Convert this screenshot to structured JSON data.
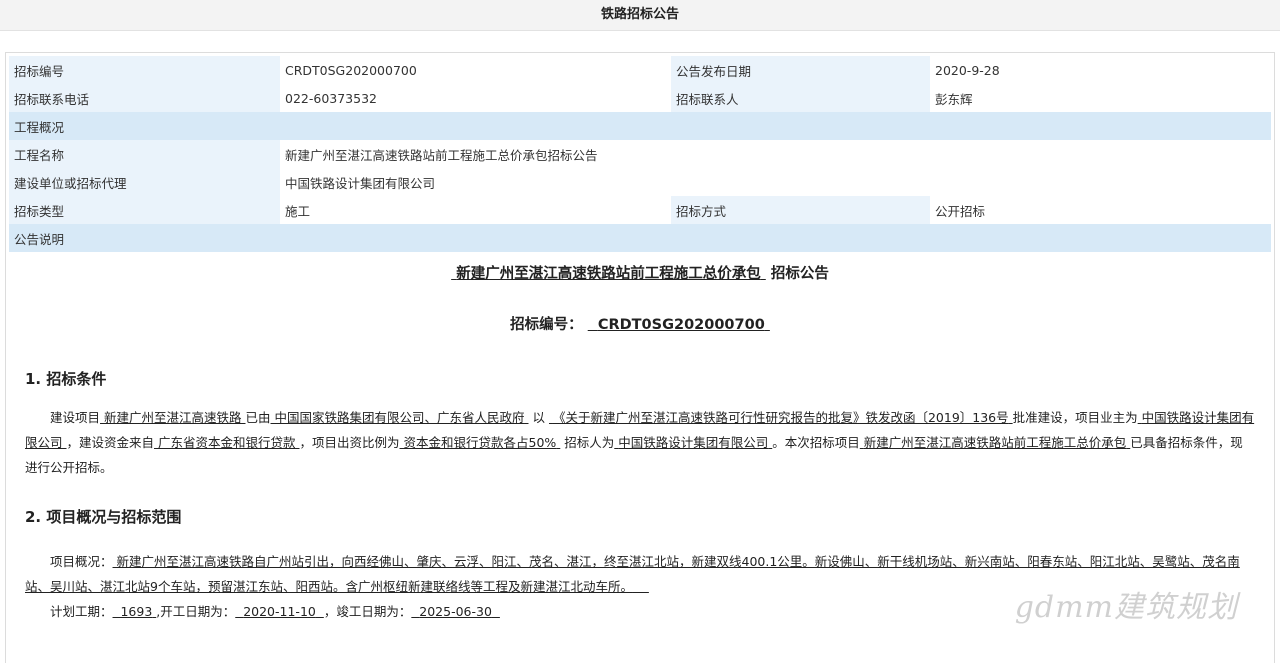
{
  "page_title": "铁路招标公告",
  "info": {
    "bid_no_label": "招标编号",
    "bid_no": "CRDT0SG202000700",
    "pub_date_label": "公告发布日期",
    "pub_date": "2020-9-28",
    "phone_label": "招标联系电话",
    "phone": "022-60373532",
    "contact_label": "招标联系人",
    "contact": "彭东辉",
    "overview_section": "工程概况",
    "project_name_label": "工程名称",
    "project_name": "新建广州至湛江高速铁路站前工程施工总价承包招标公告",
    "org_label": "建设单位或招标代理",
    "org": "中国铁路设计集团有限公司",
    "type_label": "招标类型",
    "type": "施工",
    "method_label": "招标方式",
    "method": "公开招标",
    "notice_section": "公告说明"
  },
  "doc": {
    "title_prefix": "新建广州至湛江高速铁路站前工程施工总价承包",
    "title_suffix": "招标公告",
    "bid_no_label": "招标编号：",
    "bid_no": "CRDT0SG202000700",
    "sec1_heading": "1. 招标条件",
    "sec1": {
      "t1": "建设项目",
      "u1": "新建广州至湛江高速铁路",
      "t2": "已由",
      "u2": "中国国家铁路集团有限公司、广东省人民政府",
      "t3": "以",
      "u3": "《关于新建广州至湛江高速铁路可行性研究报告的批复》铁发改函〔2019〕136号",
      "t4": "批准建设，项目业主为",
      "u4": "中国铁路设计集团有限公司",
      "t5": "，建设资金来自",
      "u5": "广东省资本金和银行贷款",
      "t6": "，项目出资比例为",
      "u6": "资本金和银行贷款各占50%",
      "t7": "招标人为",
      "u7": "中国铁路设计集团有限公司",
      "t8": "。本次招标项目",
      "u8": "新建广州至湛江高速铁路站前工程施工总价承包",
      "t9": "已具备招标条件，现进行公开招标。"
    },
    "sec2_heading": "2. 项目概况与招标范围",
    "sec2": {
      "t1": "项目概况：",
      "u1": "新建广州至湛江高速铁路自广州站引出，向西经佛山、肇庆、云浮、阳江、茂名、湛江，终至湛江北站，新建双线400.1公里。新设佛山、新干线机场站、新兴南站、阳春东站、阳江北站、吴鹭站、茂名南站、吴川站、湛江北站9个车站，预留湛江东站、阳西站。含广州枢纽新建联络线等工程及新建湛江北动车所。"
    },
    "plan": {
      "period_label": "计划工期：",
      "period": "1693",
      "start_label": ",开工日期为：",
      "start": "2020-11-10",
      "end_label": "，竣工日期为：",
      "end": "2025-06-30"
    },
    "watermark": "gdmm建筑规划"
  }
}
